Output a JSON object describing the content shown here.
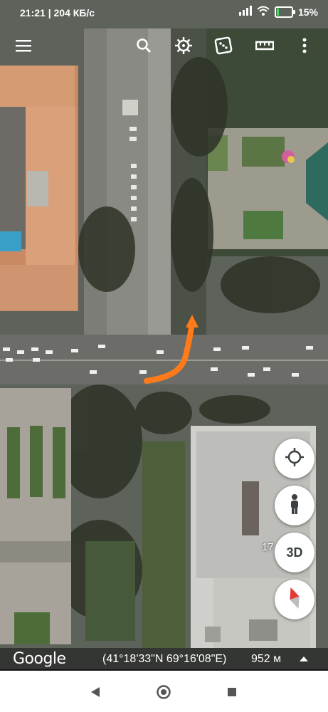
{
  "status_bar": {
    "time_speed": "21:21 | 204 КБ/с",
    "battery_percent": "15%",
    "battery_level": 0.15,
    "icons": [
      "signal-icon",
      "wifi-icon",
      "battery-icon"
    ]
  },
  "toolbar": {
    "icons": [
      "menu-icon",
      "search-icon",
      "voyager-helm-icon",
      "dice-icon",
      "ruler-icon",
      "more-vert-icon"
    ]
  },
  "map": {
    "zoom_level": "17",
    "three_d_label": "3D",
    "route_arrow_color": "#ff7a1a"
  },
  "bottom_bar": {
    "logo_text": "Google",
    "coordinates": "(41°18'33\"N 69°16'08\"E)",
    "altitude": "952 м"
  },
  "colors": {
    "accent": "#ff7a1a",
    "battery_fill": "#3ee05a",
    "compass_red": "#e53935"
  }
}
